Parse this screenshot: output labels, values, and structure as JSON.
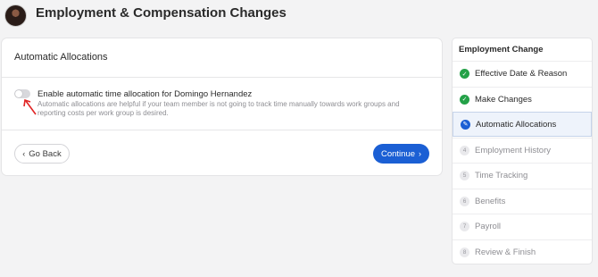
{
  "header": {
    "title": "Employment & Compensation Changes"
  },
  "card": {
    "title": "Automatic Allocations",
    "toggle_label": "Enable automatic time allocation for Domingo Hernandez",
    "toggle_description": "Automatic allocations are helpful if your team member is not going to track time manually towards work groups and reporting costs per work group is desired.",
    "toggle_on": false,
    "back_label": "Go Back",
    "continue_label": "Continue"
  },
  "sidebar": {
    "title": "Employment Change",
    "steps": [
      {
        "label": "Effective Date & Reason",
        "status": "done",
        "marker": "✓"
      },
      {
        "label": "Make Changes",
        "status": "done",
        "marker": "✓"
      },
      {
        "label": "Automatic Allocations",
        "status": "current",
        "marker": "✎"
      },
      {
        "label": "Employment History",
        "status": "todo",
        "marker": "4"
      },
      {
        "label": "Time Tracking",
        "status": "todo",
        "marker": "5"
      },
      {
        "label": "Benefits",
        "status": "todo",
        "marker": "6"
      },
      {
        "label": "Payroll",
        "status": "todo",
        "marker": "7"
      },
      {
        "label": "Review & Finish",
        "status": "todo",
        "marker": "8"
      }
    ]
  },
  "colors": {
    "accent": "#1b5fd4",
    "done": "#24a148",
    "annotation": "#e02424"
  }
}
